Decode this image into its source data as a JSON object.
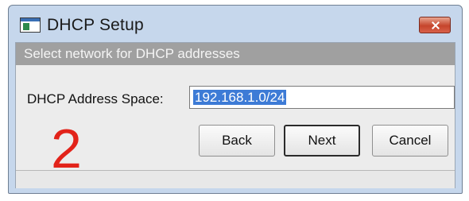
{
  "window": {
    "title": "DHCP Setup",
    "icon": "app-window-icon",
    "close_icon": "close-icon"
  },
  "header": {
    "instruction": "Select network for DHCP addresses"
  },
  "form": {
    "address_space_label": "DHCP Address Space:",
    "address_space_value": "192.168.1.0/24"
  },
  "annotation": {
    "step_number": "2",
    "color": "#e2231a"
  },
  "buttons": {
    "back": "Back",
    "next": "Next",
    "cancel": "Cancel"
  }
}
